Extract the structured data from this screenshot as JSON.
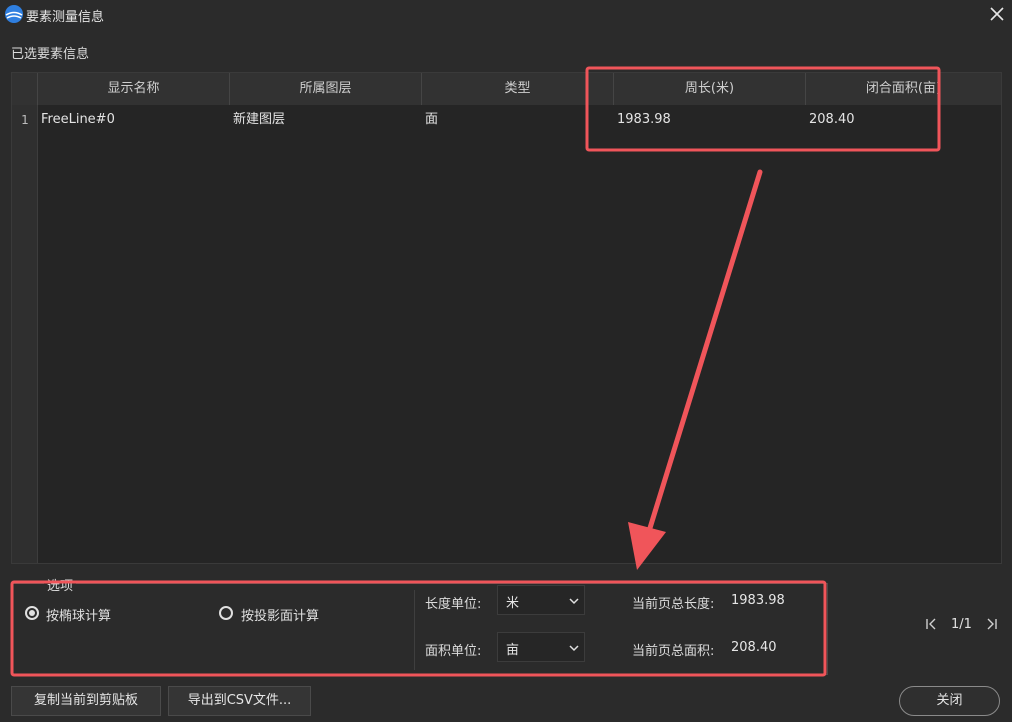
{
  "window": {
    "title": "要素测量信息",
    "icons": {
      "logo": "app-logo-icon",
      "close": "close-icon"
    }
  },
  "section_label": "已选要素信息",
  "table": {
    "columns": [
      "显示名称",
      "所属图层",
      "类型",
      "周长(米)",
      "闭合面积(亩)"
    ],
    "rows": [
      {
        "index": "1",
        "name": "FreeLine#0",
        "layer": "新建图层",
        "type": "面",
        "perimeter": "1983.98",
        "area": "208.40"
      }
    ]
  },
  "options": {
    "legend": "选项",
    "radio_ellipsoid": {
      "label": "按椭球计算",
      "checked": true
    },
    "radio_projection": {
      "label": "按投影面计算",
      "checked": false
    },
    "length_unit": {
      "label": "长度单位:",
      "value": "米"
    },
    "area_unit": {
      "label": "面积单位:",
      "value": "亩"
    },
    "total_length": {
      "label": "当前页总长度:",
      "value": "1983.98"
    },
    "total_area": {
      "label": "当前页总面积:",
      "value": "208.40"
    }
  },
  "pager": {
    "text": "1/1",
    "icons": {
      "first": "first-page-icon",
      "next": "next-page-icon"
    }
  },
  "buttons": {
    "copy": "复制当前到剪贴板",
    "export": "导出到CSV文件...",
    "close": "关闭"
  },
  "annotation_color": "#f0555a"
}
